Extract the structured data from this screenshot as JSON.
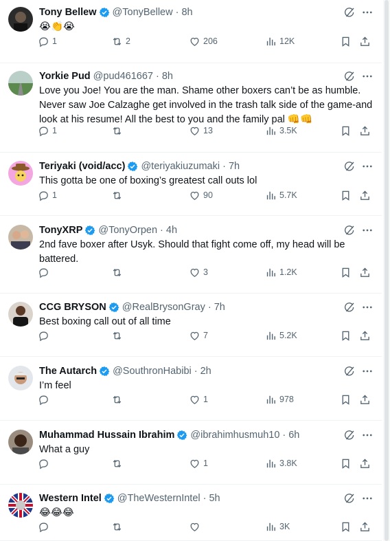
{
  "tweets": [
    {
      "name": "Tony Bellew",
      "verified": true,
      "handle": "@TonyBellew",
      "time": "8h",
      "text": "😭👏😭",
      "replies": "1",
      "retweets": "2",
      "likes": "206",
      "views": "12K",
      "avatar": "dark-profile"
    },
    {
      "name": "Yorkie Pud",
      "verified": false,
      "handle": "@pud461667",
      "time": "8h",
      "text": "Love you Joe! You are the man. Shame other boxers can’t be as humble. Never saw Joe Calzaghe get involved in the trash talk side of the game-and look at his resume! All the best to you and the family pal 👊👊",
      "replies": "1",
      "retweets": "",
      "likes": "13",
      "views": "3.5K",
      "avatar": "road-landscape"
    },
    {
      "name": "Teriyaki (void/acc)",
      "verified": true,
      "handle": "@teriyakiuzumaki",
      "time": "7h",
      "text": "This gotta be one of boxing’s greatest call outs lol",
      "replies": "1",
      "retweets": "",
      "likes": "90",
      "views": "5.7K",
      "avatar": "pink-cowboy"
    },
    {
      "name": "TonyXRP",
      "verified": true,
      "handle": "@TonyOrpen",
      "time": "4h",
      "text": "2nd fave boxer after Usyk. Should that fight come off, my head will be battered.",
      "replies": "",
      "retweets": "",
      "likes": "3",
      "views": "1.2K",
      "avatar": "couple-photo"
    },
    {
      "name": "CCG BRYSON",
      "verified": true,
      "handle": "@RealBrysonGray",
      "time": "7h",
      "text": "Best boxing call out of all time",
      "replies": "",
      "retweets": "",
      "likes": "7",
      "views": "5.2K",
      "avatar": "man-black-shirt"
    },
    {
      "name": "The Autarch",
      "verified": true,
      "handle": "@SouthronHabibi",
      "time": "2h",
      "text": "I’m feel",
      "replies": "",
      "retweets": "",
      "likes": "1",
      "views": "978",
      "avatar": "man-cap"
    },
    {
      "name": "Muhammad Hussain Ibrahim",
      "verified": true,
      "handle": "@ibrahimhusmuh10",
      "time": "6h",
      "text": "What a guy",
      "replies": "",
      "retweets": "",
      "likes": "1",
      "views": "3.8K",
      "avatar": "man-portrait"
    },
    {
      "name": "Western Intel",
      "verified": true,
      "handle": "@TheWesternIntel",
      "time": "5h",
      "text": "😂😂😂",
      "replies": "",
      "retweets": "",
      "likes": "",
      "views": "3K",
      "avatar": "union-jack-figure"
    }
  ],
  "icons": {
    "reply": "reply-icon",
    "retweet": "retweet-icon",
    "like": "heart-icon",
    "views": "views-chart-icon",
    "bookmark": "bookmark-icon",
    "share": "share-icon",
    "grok": "grok-icon",
    "more": "more-icon",
    "verified": "verified-badge-icon"
  },
  "colors": {
    "text": "#0f1419",
    "muted": "#536471",
    "verified_blue": "#1d9bf0",
    "divider": "#eff3f4"
  }
}
